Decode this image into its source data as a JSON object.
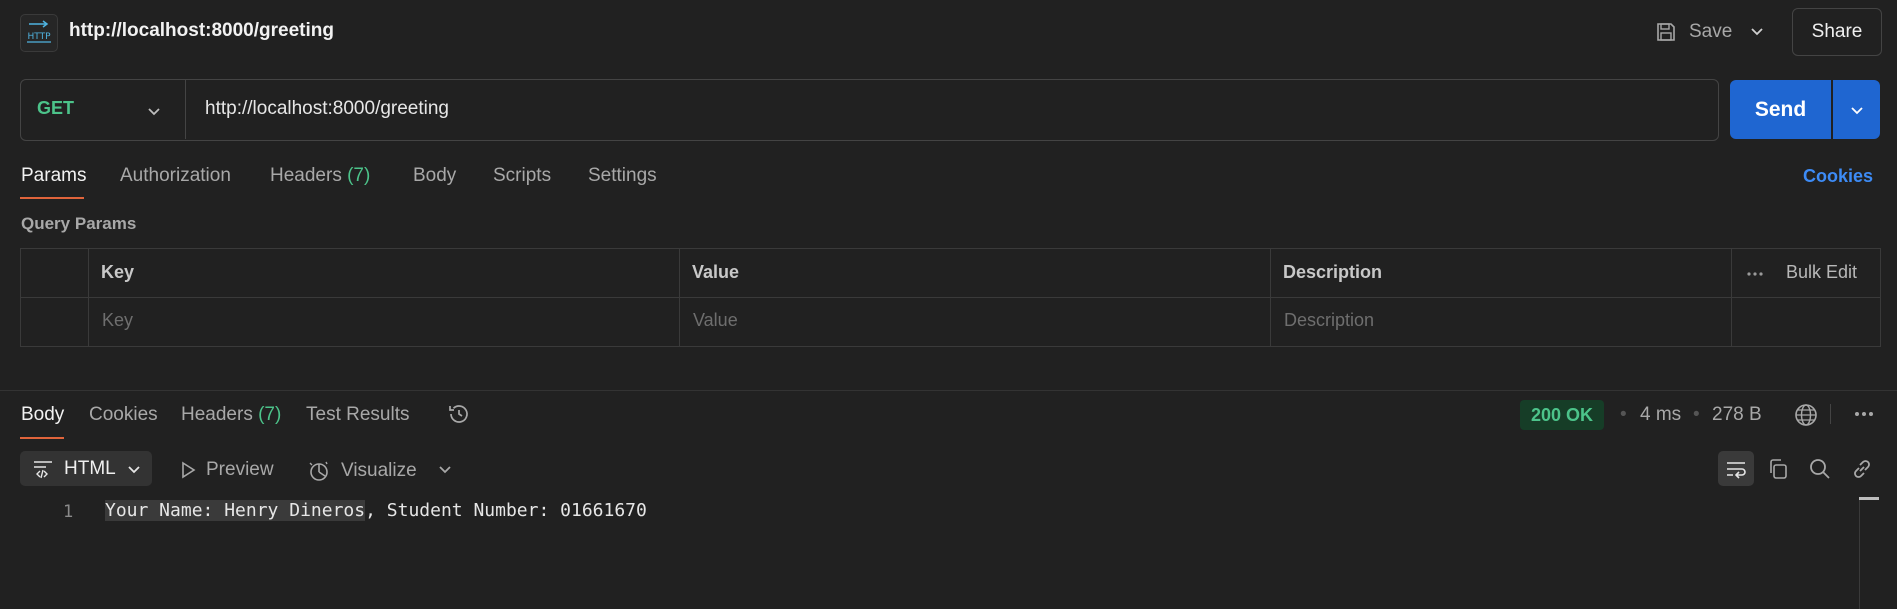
{
  "header": {
    "title": "http://localhost:8000/greeting",
    "save_label": "Save",
    "share_label": "Share",
    "http_icon_label": "HTTP"
  },
  "request": {
    "method": "GET",
    "url": "http://localhost:8000/greeting",
    "send_label": "Send"
  },
  "request_tabs": {
    "params": "Params",
    "authorization": "Authorization",
    "headers": "Headers",
    "headers_count": "(7)",
    "body": "Body",
    "scripts": "Scripts",
    "settings": "Settings",
    "active": "Params"
  },
  "cookies_link": "Cookies",
  "query_params": {
    "section_label": "Query Params",
    "columns": {
      "key": "Key",
      "value": "Value",
      "description": "Description"
    },
    "bulk_edit": "Bulk Edit",
    "placeholders": {
      "key": "Key",
      "value": "Value",
      "description": "Description"
    }
  },
  "response_tabs": {
    "body": "Body",
    "cookies": "Cookies",
    "headers": "Headers",
    "headers_count": "(7)",
    "test_results": "Test Results",
    "active": "Body"
  },
  "response_meta": {
    "status": "200 OK",
    "time": "4 ms",
    "size": "278 B"
  },
  "response_toolbar": {
    "format": "HTML",
    "preview": "Preview",
    "visualize": "Visualize"
  },
  "response_body": {
    "line_number": "1",
    "highlighted": "Your Name: Henry Dineros",
    "rest": ", Student Number: 01661670"
  },
  "colors": {
    "accent_orange": "#e0643b",
    "send_blue": "#1f66d1",
    "method_green": "#4cc38a",
    "link_blue": "#3d8bf5"
  }
}
